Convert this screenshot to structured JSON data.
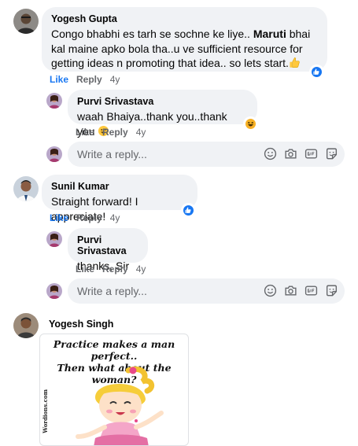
{
  "comments": [
    {
      "author": "Yogesh Gupta",
      "text_before": "Congo bhabhi es tarh se sochne ke liye.. ",
      "text_bold": "Maruti",
      "text_after": " bhai kal maine apko bola tha..u ve sufficient resource for getting ideas n promoting that idea.. so lets start.",
      "trailing_emoji": "thumbs-up-emoji",
      "actions": {
        "like": "Like",
        "reply": "Reply",
        "age": "4y"
      },
      "reaction": "like-reaction-icon",
      "replies": [
        {
          "author": "Purvi Srivastava",
          "text": "waah Bhaiya..thank you..thank you ",
          "trailing_emoji": "grin-emoji",
          "reaction": "haha-reaction-icon",
          "actions": {
            "like": "Like",
            "reply": "Reply",
            "age": "4y"
          }
        }
      ]
    },
    {
      "author": "Sunil Kumar",
      "text": "Straight forward! I appreciate!",
      "actions": {
        "like": "Like",
        "reply": "Reply",
        "age": "4y"
      },
      "reaction": "like-reaction-icon",
      "replies": [
        {
          "author": "Purvi Srivastava",
          "text": "thanks, Sir",
          "actions": {
            "like": "Like",
            "reply": "Reply",
            "age": "4y"
          }
        }
      ]
    },
    {
      "author": "Yogesh Singh",
      "image": {
        "caption_line1": "Practice makes a man perfect..",
        "caption_line2": "Then what about the woman?",
        "watermark": "Wordions.com"
      }
    }
  ],
  "reply_box": {
    "placeholder": "Write a reply...",
    "icons": [
      "emoji-icon",
      "camera-icon",
      "gif-icon",
      "sticker-icon"
    ]
  },
  "colors": {
    "bubble": "#f0f2f5",
    "link_blue": "#1877f2",
    "muted": "#65676b",
    "text": "#050505"
  }
}
